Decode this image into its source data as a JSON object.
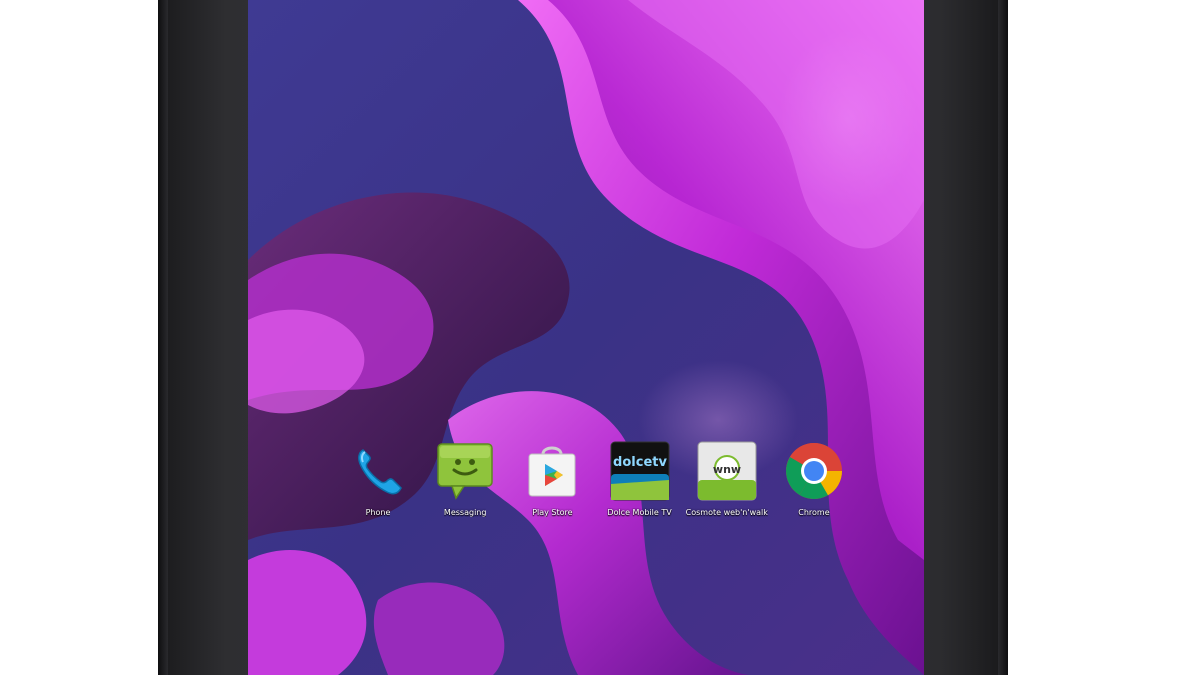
{
  "device": {
    "bezel_color": "#2e2e31",
    "screen_accent": "#c12ad8",
    "wallpaper_base": "#3b3484"
  },
  "dock": {
    "apps": [
      {
        "label": "Phone",
        "icon": "phone-icon"
      },
      {
        "label": "Messaging",
        "icon": "messaging-icon"
      },
      {
        "label": "Play Store",
        "icon": "play-store-icon"
      },
      {
        "label": "Dolce Mobile TV",
        "icon": "dolce-tv-icon"
      },
      {
        "label": "Cosmote web'n'walk",
        "icon": "webnwalk-icon"
      },
      {
        "label": "Chrome",
        "icon": "chrome-icon"
      }
    ]
  },
  "icon_texts": {
    "dolce_logo": "dolcetv",
    "webnwalk_logo": "wnw"
  }
}
